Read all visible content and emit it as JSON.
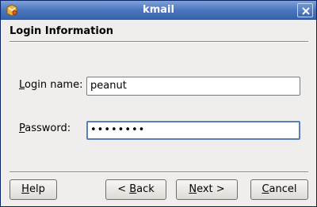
{
  "window": {
    "title": "kmail",
    "app_icon": "kmail-app-icon",
    "close_icon": "close-icon"
  },
  "page": {
    "header": "Login Information"
  },
  "form": {
    "login_label_mnemonic": "L",
    "login_label_rest": "ogin name:",
    "login_value": "peanut",
    "password_label_mnemonic": "P",
    "password_label_rest": "assword:",
    "password_value": "••••••••"
  },
  "buttons": {
    "help_mnemonic": "H",
    "help_rest": "elp",
    "back_prefix": "< ",
    "back_mnemonic": "B",
    "back_rest": "ack",
    "next_mnemonic": "N",
    "next_rest": "ext >",
    "cancel_mnemonic": "C",
    "cancel_rest": "ancel"
  },
  "colors": {
    "titlebar": "#4b76bd",
    "focus_border": "#5a7fb8"
  }
}
